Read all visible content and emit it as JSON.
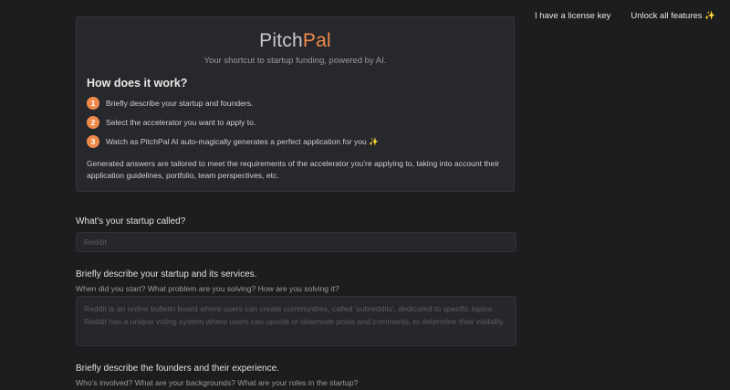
{
  "topnav": {
    "license_label": "I have a license key",
    "unlock_label": "Unlock all features ✨"
  },
  "hero": {
    "brand_part1": "Pitch",
    "brand_part2": "Pal",
    "tagline": "Your shortcut to startup funding, powered by AI.",
    "how_title": "How does it work?",
    "steps": [
      {
        "num": "1",
        "text": "Briefly describe your startup and founders."
      },
      {
        "num": "2",
        "text": "Select the accelerator you want to apply to."
      },
      {
        "num": "3",
        "text": "Watch as PitchPal AI auto-magically generates a perfect application for you ✨"
      }
    ],
    "note": "Generated answers are tailored to meet the requirements of the accelerator you're applying to, taking into account their application guidelines, portfolio, team perspectives, etc."
  },
  "form": {
    "startup_name": {
      "label": "What's your startup called?",
      "placeholder": "Reddit",
      "value": ""
    },
    "startup_description": {
      "label": "Briefly describe your startup and its services.",
      "help": "When did you start? What problem are you solving? How are you solving it?",
      "placeholder": "Reddit is an online bulletin board where users can create communities, called 'subreddits', dedicated to specific topics. Reddit has a unique voting system where users can upvote or downvote posts and comments, to determine their visibility.",
      "value": ""
    },
    "founders": {
      "label": "Briefly describe the founders and their experience.",
      "help": "Who's involved? What are your backgrounds? What are your roles in the startup?"
    }
  },
  "colors": {
    "accent": "#f08a4b",
    "background": "#1c1d1f",
    "card": "#27282b"
  }
}
